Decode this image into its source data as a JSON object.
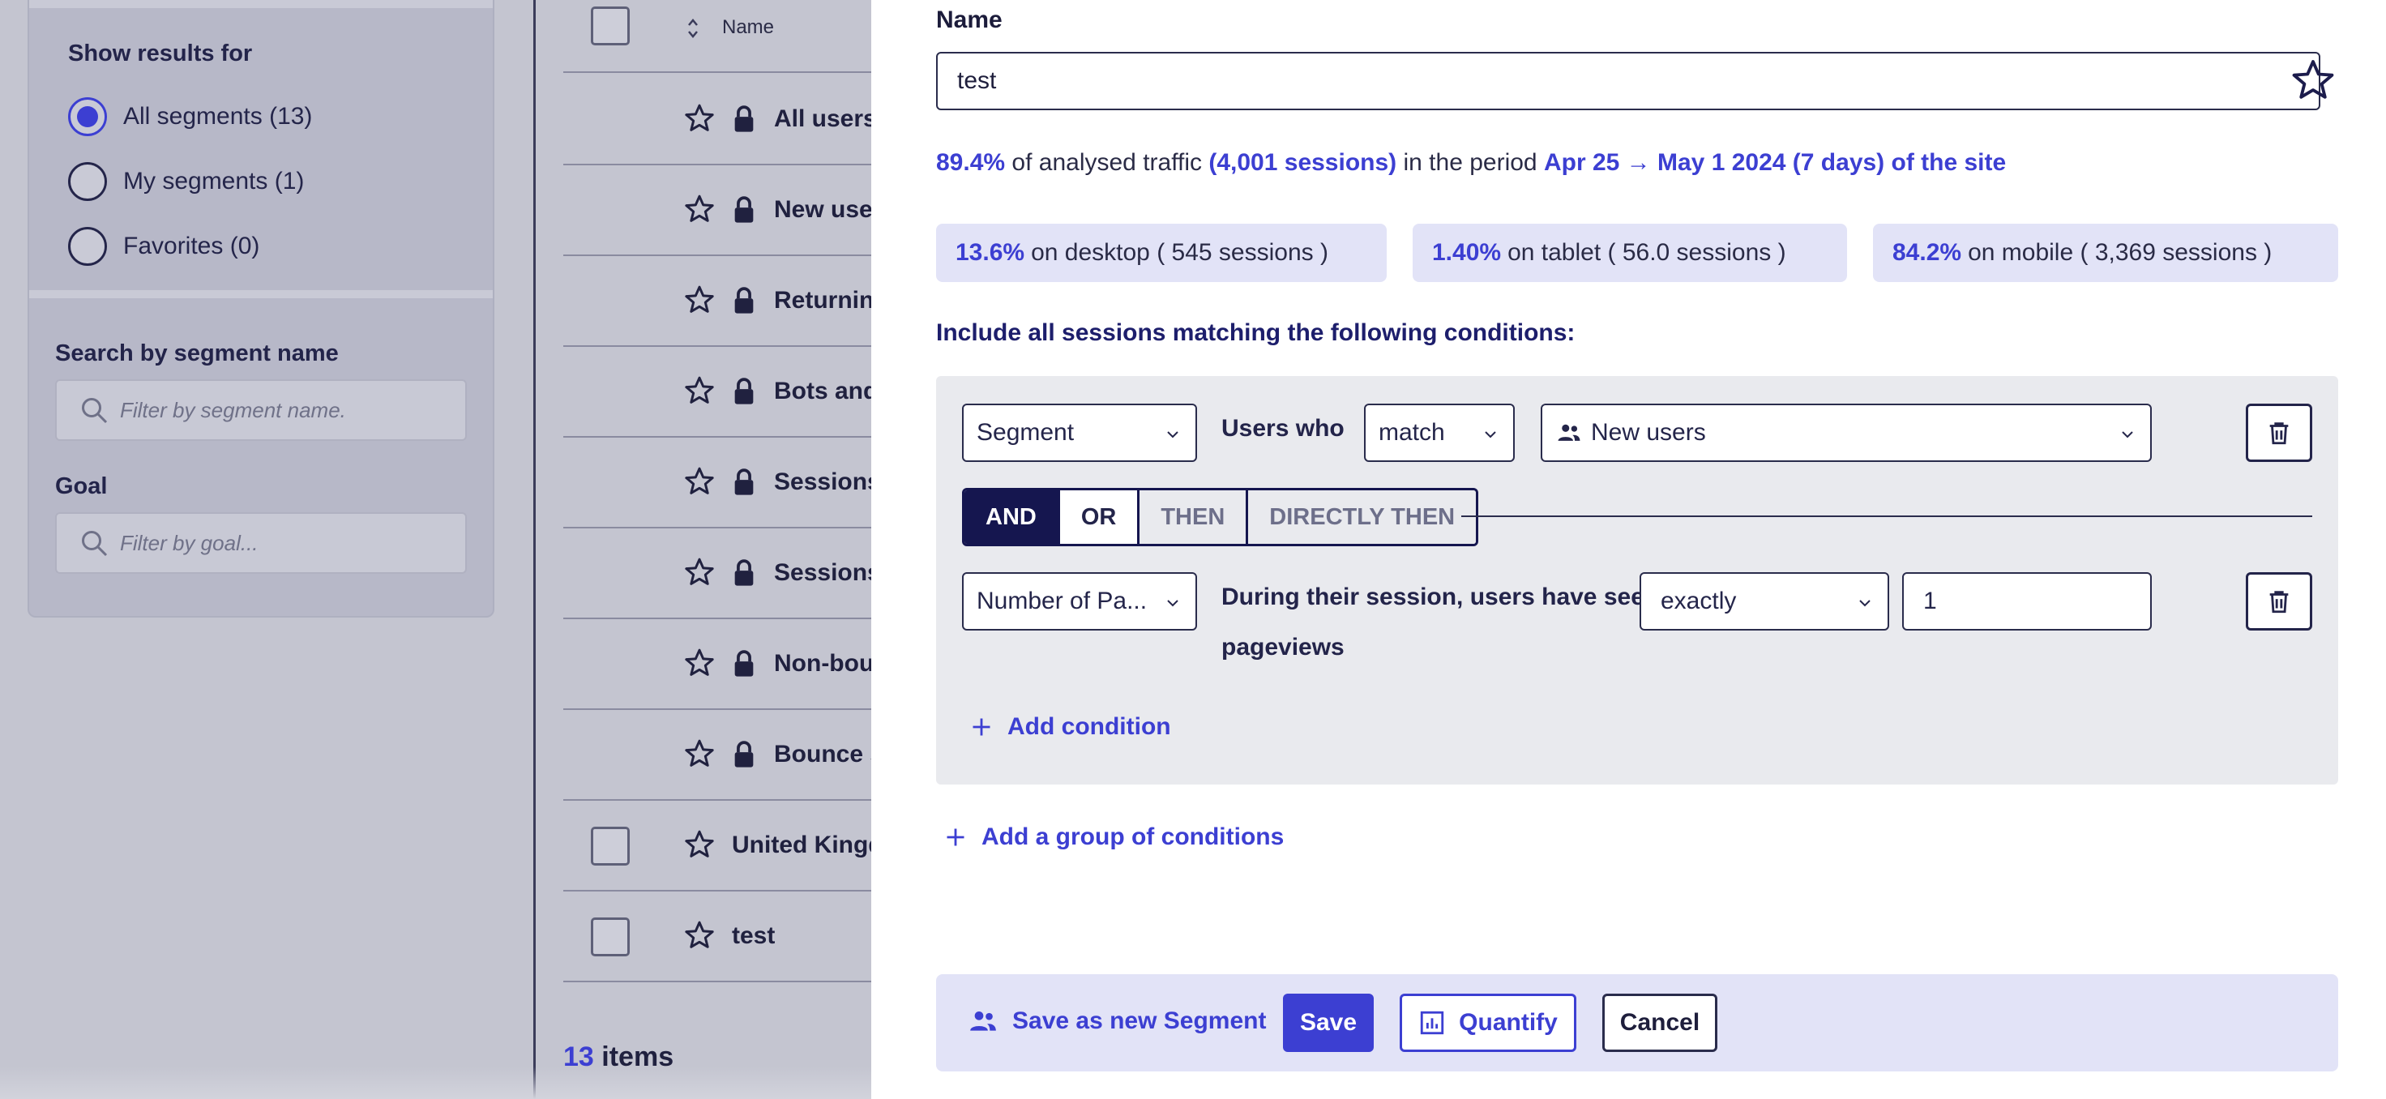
{
  "sidebar": {
    "show_results_title": "Show results for",
    "radios": [
      {
        "label": "All segments (13)",
        "selected": true
      },
      {
        "label": "My segments (1)",
        "selected": false
      },
      {
        "label": "Favorites (0)",
        "selected": false
      }
    ],
    "search_title": "Search by segment name",
    "search_placeholder": "Filter by segment name.",
    "goal_title": "Goal",
    "goal_placeholder": "Filter by goal..."
  },
  "list": {
    "header_name": "Name",
    "rows": [
      {
        "label": "All users",
        "locked": true
      },
      {
        "label": "New users",
        "locked": true
      },
      {
        "label": "Returning users",
        "locked": true
      },
      {
        "label": "Bots and crawlers",
        "locked": true
      },
      {
        "label": "Sessions with conversion",
        "locked": true
      },
      {
        "label": "Sessions without conversion",
        "locked": true
      },
      {
        "label": "Non-bounce sessions",
        "locked": true
      },
      {
        "label": "Bounce sessions",
        "locked": true
      },
      {
        "label": "United Kingdom",
        "locked": false
      },
      {
        "label": "test",
        "locked": false
      }
    ],
    "count_number": "13",
    "count_label": "items"
  },
  "drawer": {
    "name_label": "Name",
    "name_value": "test",
    "traffic": {
      "pct": "89.4%",
      "text1": "of analysed traffic",
      "sessions": "(4,001 sessions)",
      "text2": "in the period",
      "period": "Apr 25 → May 1 2024 (7 days) of the site"
    },
    "devices": [
      {
        "pct": "13.6%",
        "text": "on desktop ( 545 sessions )"
      },
      {
        "pct": "1.40%",
        "text": "on tablet ( 56.0 sessions )"
      },
      {
        "pct": "84.2%",
        "text": "on mobile ( 3,369 sessions )"
      }
    ],
    "include_title": "Include all sessions matching the following conditions:",
    "condition1": {
      "type": "Segment",
      "who_label": "Users who",
      "operator": "match",
      "value": "New users"
    },
    "operators": {
      "and": "AND",
      "or": "OR",
      "then": "THEN",
      "directly_then": "DIRECTLY THEN"
    },
    "condition2": {
      "type": "Number of Pa...",
      "desc_line1": "During their session, users have seen",
      "desc_line2": "pageviews",
      "operator": "exactly",
      "value": "1"
    },
    "add_condition": "Add condition",
    "add_group": "Add a group of conditions",
    "footer": {
      "save_new": "Save as new Segment",
      "save": "Save",
      "quantify": "Quantify",
      "cancel": "Cancel"
    }
  },
  "colors": {
    "accent": "#3c3fd2",
    "navy": "#15164f",
    "overlay_bg": "#c4c5d0",
    "chip_bg": "#e2e3f7",
    "conditions_bg": "#e9eaee"
  }
}
